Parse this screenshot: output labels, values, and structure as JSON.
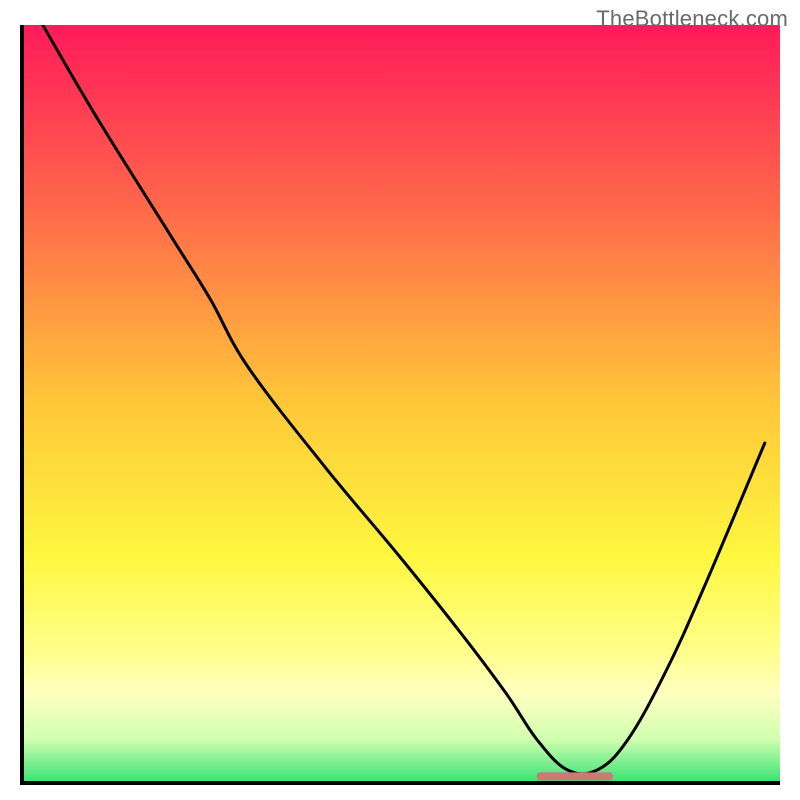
{
  "watermark": "TheBottleneck.com",
  "chart_data": {
    "type": "line",
    "title": "",
    "xlabel": "",
    "ylabel": "",
    "xlim": [
      0,
      100
    ],
    "ylim": [
      0,
      100
    ],
    "x": [
      3,
      10,
      20,
      25,
      30,
      40,
      50,
      58,
      64,
      68,
      72,
      76,
      80,
      85,
      90,
      98
    ],
    "values": [
      100,
      88,
      72,
      64,
      55,
      42,
      30,
      20,
      12,
      6,
      2,
      2,
      6,
      15,
      26,
      45
    ],
    "minimum_marker": {
      "x_start": 68,
      "x_end": 78,
      "y": 1,
      "color": "#c97a7a"
    },
    "gradient_stops": [
      {
        "offset": 0,
        "color": "#ff1a5a"
      },
      {
        "offset": 25,
        "color": "#ff6b4a"
      },
      {
        "offset": 50,
        "color": "#ffc838"
      },
      {
        "offset": 70,
        "color": "#fff740"
      },
      {
        "offset": 82,
        "color": "#ffff88"
      },
      {
        "offset": 88,
        "color": "#ffffc0"
      },
      {
        "offset": 94,
        "color": "#d0ffb0"
      },
      {
        "offset": 100,
        "color": "#2ee070"
      }
    ]
  }
}
